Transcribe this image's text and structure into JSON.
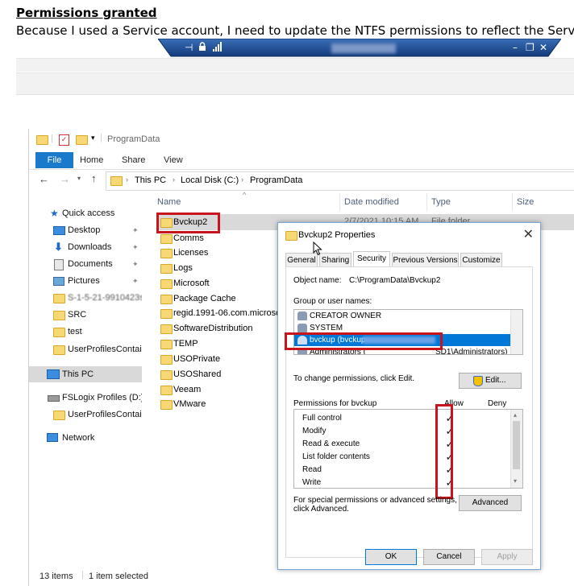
{
  "document": {
    "title": "Permissions granted",
    "line": "Because I used a Service account, I need to update the NTFS permissions to reflect the Servic"
  },
  "remote_bar": {
    "icons": [
      "pin-icon",
      "lock-icon",
      "signal-icon",
      "minimize-icon",
      "restore-icon",
      "close-icon"
    ],
    "color": "#17468c"
  },
  "explorer": {
    "title_path": "ProgramData",
    "ribbon_tabs": [
      "File",
      "Home",
      "Share",
      "View"
    ],
    "breadcrumb": [
      "This PC",
      "Local Disk (C:)",
      "ProgramData"
    ],
    "columns": {
      "name": "Name",
      "date": "Date modified",
      "type": "Type",
      "size": "Size"
    },
    "first_row_date": "2/7/2021 10:15 AM",
    "first_row_type": "File folder",
    "nav": {
      "quick_access": "Quick access",
      "desktop": "Desktop",
      "downloads": "Downloads",
      "documents": "Documents",
      "pictures": "Pictures",
      "sid_folder": "S-1-5-21-9910423s-",
      "src": "SRC",
      "test": "test",
      "upc1": "UserProfilesContain",
      "this_pc": "This PC",
      "fslogix": "FSLogix Profiles (D:)",
      "upc2": "UserProfilesContain",
      "network": "Network"
    },
    "files": [
      "Bvckup2",
      "Comms",
      "Licenses",
      "Logs",
      "Microsoft",
      "Package Cache",
      "regid.1991-06.com.microsof",
      "SoftwareDistribution",
      "TEMP",
      "USOPrivate",
      "USOShared",
      "Veeam",
      "VMware"
    ],
    "status": {
      "count": "13 items",
      "selected": "1 item selected"
    }
  },
  "dialog": {
    "title": "Bvckup2 Properties",
    "tabs": [
      "General",
      "Sharing",
      "Security",
      "Previous Versions",
      "Customize"
    ],
    "active_tab": "Security",
    "object_label": "Object name:",
    "object_value": "C:\\ProgramData\\Bvckup2",
    "group_label": "Group or user names:",
    "users": [
      "CREATOR OWNER",
      "SYSTEM",
      "bvckup (bvckup",
      "Administrators ("
    ],
    "admin_suffix": "SD1\\Administrators)",
    "change_text": "To change permissions, click Edit.",
    "edit_button": "Edit...",
    "perm_label": "Permissions for bvckup",
    "allow": "Allow",
    "deny": "Deny",
    "permissions": [
      "Full control",
      "Modify",
      "Read & execute",
      "List folder contents",
      "Read",
      "Write"
    ],
    "check_glyph": "✓",
    "special_text_1": "For special permissions or advanced settings,",
    "special_text_2": "click Advanced.",
    "advanced_button": "Advanced",
    "ok": "OK",
    "cancel": "Cancel",
    "apply": "Apply"
  },
  "colors": {
    "highlight": "#c8151d",
    "file_tab": "#1979ca",
    "selection": "#0078d7"
  }
}
